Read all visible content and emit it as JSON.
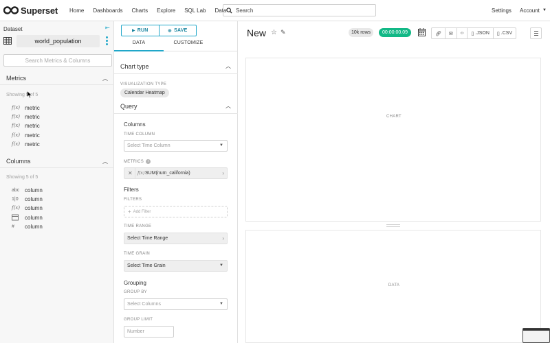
{
  "nav": {
    "brand": "Superset",
    "items": [
      "Home",
      "Dashboards",
      "Charts",
      "Explore",
      "SQL Lab",
      "Data"
    ],
    "search_placeholder": "Search",
    "settings": "Settings",
    "account": "Account"
  },
  "dataset_panel": {
    "title": "Dataset",
    "dataset_name": "world_population",
    "search_placeholder": "Search Metrics & Columns",
    "metrics": {
      "header": "Metrics",
      "showing": "Showing 5 of 5",
      "items": [
        {
          "icon": "f(x)",
          "label": "metric"
        },
        {
          "icon": "f(x)",
          "label": "metric"
        },
        {
          "icon": "f(x)",
          "label": "metric"
        },
        {
          "icon": "f(x)",
          "label": "metric"
        },
        {
          "icon": "f(x)",
          "label": "metric"
        }
      ]
    },
    "columns": {
      "header": "Columns",
      "showing": "Showing 5 of 5",
      "items": [
        {
          "icon": "abc",
          "label": "column"
        },
        {
          "icon": "1|0",
          "label": "column"
        },
        {
          "icon": "f(x)",
          "label": "column"
        },
        {
          "icon": "calendar-icon",
          "label": "column"
        },
        {
          "icon": "#",
          "label": "column"
        }
      ]
    }
  },
  "control_panel": {
    "run_label": "RUN",
    "save_label": "SAVE",
    "tabs": [
      "DATA",
      "CUSTOMIZE"
    ],
    "chart_type_header": "Chart type",
    "viz_type_caption": "VISUALIZATION TYPE",
    "viz_type_value": "Calendar Heatmap",
    "query_header": "Query",
    "columns_title": "Columns",
    "time_column_caption": "TIME COLUMN",
    "time_column_placeholder": "Select Time Column",
    "metrics_caption": "METRICS",
    "metric_value": "SUM(num_california)",
    "filters_title": "Filters",
    "filters_caption": "FILTERS",
    "add_filter": "Add Filter",
    "time_range_caption": "TIME RANGE",
    "time_range_value": "Select Time Range",
    "time_grain_caption": "TIME GRAIN",
    "time_grain_value": "Select Time Grain",
    "grouping_title": "Grouping",
    "group_by_caption": "GROUP BY",
    "group_by_placeholder": "Select Columns",
    "group_limit_caption": "GROUP LIMIT",
    "group_limit_placeholder": "Number"
  },
  "chart_area": {
    "title": "New",
    "rows_badge": "10k rows",
    "timer": "00:00:00.09",
    "json_label": ".JSON",
    "csv_label": ".CSV",
    "chart_placeholder": "CHART",
    "data_placeholder": "DATA"
  },
  "colors": {
    "accent": "#20a7c9",
    "success": "#12b886"
  }
}
